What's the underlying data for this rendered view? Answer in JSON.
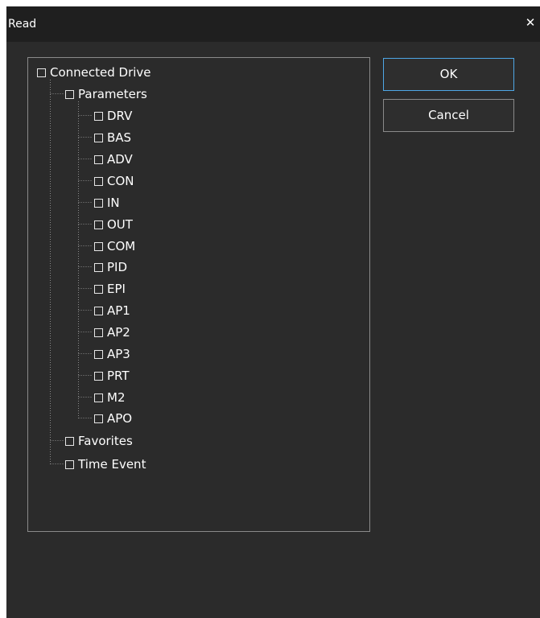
{
  "dialog": {
    "title": "Read",
    "close_symbol": "✕"
  },
  "tree": {
    "root": "Connected Drive",
    "parameters_label": "Parameters",
    "parameter_groups": [
      "DRV",
      "BAS",
      "ADV",
      "CON",
      "IN",
      "OUT",
      "COM",
      "PID",
      "EPI",
      "AP1",
      "AP2",
      "AP3",
      "PRT",
      "M2",
      "APO"
    ],
    "favorites_label": "Favorites",
    "time_event_label": "Time Event"
  },
  "buttons": {
    "ok_label": "OK",
    "cancel_label": "Cancel"
  },
  "colors": {
    "dialog_background": "#2b2b2b",
    "title_bar": "#1f1f1f",
    "accent_border": "#4ea7e6",
    "text": "#ffffff"
  },
  "icons": {
    "close": "close-icon",
    "checkbox": "checkbox-icon"
  }
}
